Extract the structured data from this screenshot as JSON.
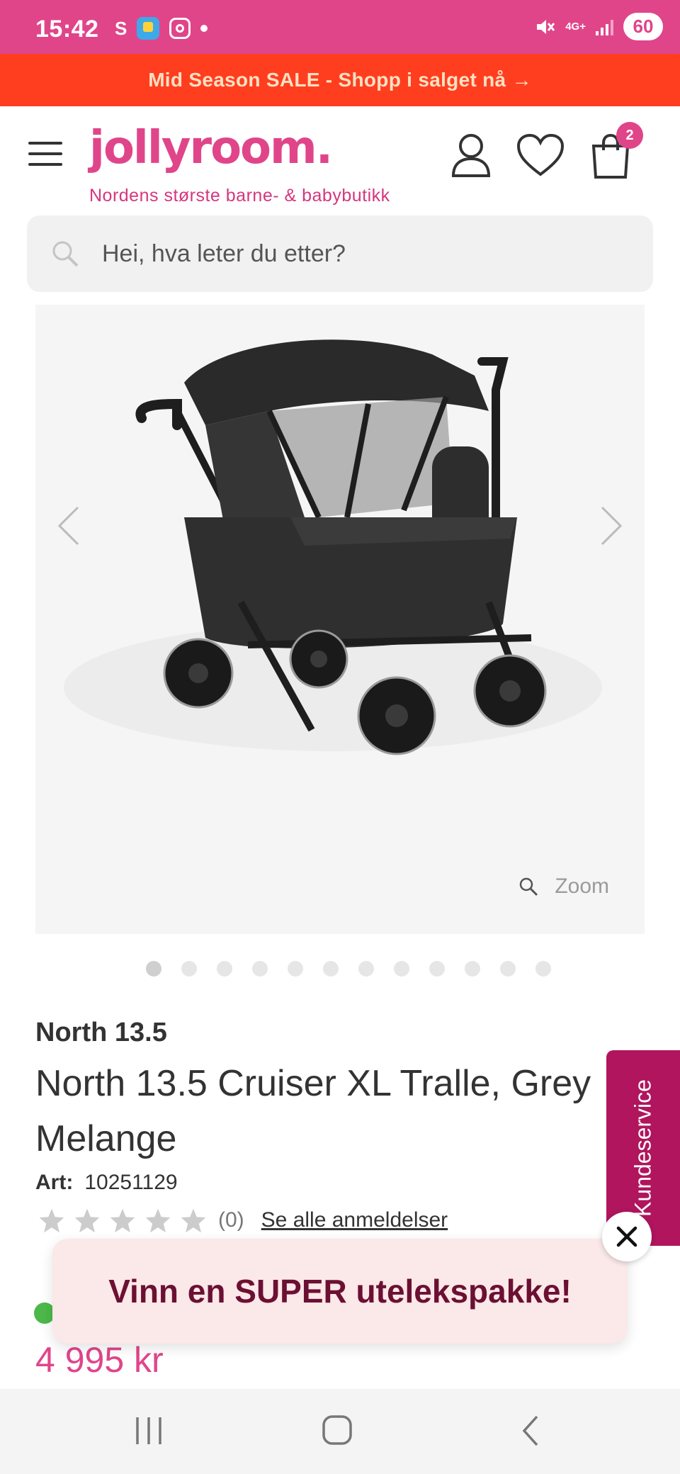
{
  "status_bar": {
    "time": "15:42",
    "left_letter": "S",
    "network": "4G+",
    "battery": "60",
    "icons": [
      "app-icon",
      "instagram-icon",
      "dot-icon",
      "mute-icon",
      "signal-icon",
      "battery-icon"
    ]
  },
  "promo": {
    "text": "Mid Season SALE - Shopp i salget nå →"
  },
  "header": {
    "logo": "jollyroom.",
    "tagline": "Nordens største barne- & babybutikk",
    "cart_count": "2",
    "icons": [
      "menu-icon",
      "user-icon",
      "heart-icon",
      "bag-icon"
    ]
  },
  "search": {
    "placeholder": "Hei, hva leter du etter?"
  },
  "gallery": {
    "zoom_label": "Zoom",
    "dot_count": 12,
    "active_index": 0
  },
  "product": {
    "brand": "North 13.5",
    "title_line1": "North 13.5 Cruiser XL Tralle, Grey",
    "title_line2": "Melange",
    "art_label": "Art:",
    "art_number": "10251129",
    "rating_count": "(0)",
    "reviews_link": "Se alle anmeldelser",
    "price": "4 995 kr"
  },
  "side_tab": {
    "label": "Kundeservice"
  },
  "popup": {
    "text": "Vinn en SUPER utelekspakke!"
  },
  "colors": {
    "brand_pink": "#e0458a",
    "promo_red": "#ff3e1f",
    "side_tab": "#b0155e",
    "popup_text": "#6b1033",
    "stock_green": "#4cb84a"
  }
}
